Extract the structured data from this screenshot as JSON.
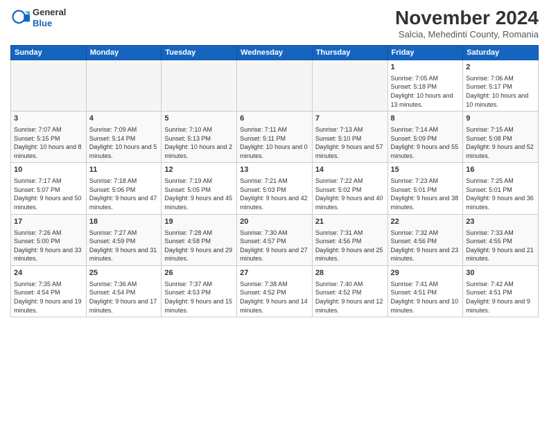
{
  "logo": {
    "general": "General",
    "blue": "Blue"
  },
  "header": {
    "month": "November 2024",
    "location": "Salcia, Mehedinti County, Romania"
  },
  "weekdays": [
    "Sunday",
    "Monday",
    "Tuesday",
    "Wednesday",
    "Thursday",
    "Friday",
    "Saturday"
  ],
  "weeks": [
    [
      {
        "day": "",
        "info": ""
      },
      {
        "day": "",
        "info": ""
      },
      {
        "day": "",
        "info": ""
      },
      {
        "day": "",
        "info": ""
      },
      {
        "day": "",
        "info": ""
      },
      {
        "day": "1",
        "info": "Sunrise: 7:05 AM\nSunset: 5:18 PM\nDaylight: 10 hours and 13 minutes."
      },
      {
        "day": "2",
        "info": "Sunrise: 7:06 AM\nSunset: 5:17 PM\nDaylight: 10 hours and 10 minutes."
      }
    ],
    [
      {
        "day": "3",
        "info": "Sunrise: 7:07 AM\nSunset: 5:15 PM\nDaylight: 10 hours and 8 minutes."
      },
      {
        "day": "4",
        "info": "Sunrise: 7:09 AM\nSunset: 5:14 PM\nDaylight: 10 hours and 5 minutes."
      },
      {
        "day": "5",
        "info": "Sunrise: 7:10 AM\nSunset: 5:13 PM\nDaylight: 10 hours and 2 minutes."
      },
      {
        "day": "6",
        "info": "Sunrise: 7:11 AM\nSunset: 5:11 PM\nDaylight: 10 hours and 0 minutes."
      },
      {
        "day": "7",
        "info": "Sunrise: 7:13 AM\nSunset: 5:10 PM\nDaylight: 9 hours and 57 minutes."
      },
      {
        "day": "8",
        "info": "Sunrise: 7:14 AM\nSunset: 5:09 PM\nDaylight: 9 hours and 55 minutes."
      },
      {
        "day": "9",
        "info": "Sunrise: 7:15 AM\nSunset: 5:08 PM\nDaylight: 9 hours and 52 minutes."
      }
    ],
    [
      {
        "day": "10",
        "info": "Sunrise: 7:17 AM\nSunset: 5:07 PM\nDaylight: 9 hours and 50 minutes."
      },
      {
        "day": "11",
        "info": "Sunrise: 7:18 AM\nSunset: 5:06 PM\nDaylight: 9 hours and 47 minutes."
      },
      {
        "day": "12",
        "info": "Sunrise: 7:19 AM\nSunset: 5:05 PM\nDaylight: 9 hours and 45 minutes."
      },
      {
        "day": "13",
        "info": "Sunrise: 7:21 AM\nSunset: 5:03 PM\nDaylight: 9 hours and 42 minutes."
      },
      {
        "day": "14",
        "info": "Sunrise: 7:22 AM\nSunset: 5:02 PM\nDaylight: 9 hours and 40 minutes."
      },
      {
        "day": "15",
        "info": "Sunrise: 7:23 AM\nSunset: 5:01 PM\nDaylight: 9 hours and 38 minutes."
      },
      {
        "day": "16",
        "info": "Sunrise: 7:25 AM\nSunset: 5:01 PM\nDaylight: 9 hours and 36 minutes."
      }
    ],
    [
      {
        "day": "17",
        "info": "Sunrise: 7:26 AM\nSunset: 5:00 PM\nDaylight: 9 hours and 33 minutes."
      },
      {
        "day": "18",
        "info": "Sunrise: 7:27 AM\nSunset: 4:59 PM\nDaylight: 9 hours and 31 minutes."
      },
      {
        "day": "19",
        "info": "Sunrise: 7:28 AM\nSunset: 4:58 PM\nDaylight: 9 hours and 29 minutes."
      },
      {
        "day": "20",
        "info": "Sunrise: 7:30 AM\nSunset: 4:57 PM\nDaylight: 9 hours and 27 minutes."
      },
      {
        "day": "21",
        "info": "Sunrise: 7:31 AM\nSunset: 4:56 PM\nDaylight: 9 hours and 25 minutes."
      },
      {
        "day": "22",
        "info": "Sunrise: 7:32 AM\nSunset: 4:56 PM\nDaylight: 9 hours and 23 minutes."
      },
      {
        "day": "23",
        "info": "Sunrise: 7:33 AM\nSunset: 4:55 PM\nDaylight: 9 hours and 21 minutes."
      }
    ],
    [
      {
        "day": "24",
        "info": "Sunrise: 7:35 AM\nSunset: 4:54 PM\nDaylight: 9 hours and 19 minutes."
      },
      {
        "day": "25",
        "info": "Sunrise: 7:36 AM\nSunset: 4:54 PM\nDaylight: 9 hours and 17 minutes."
      },
      {
        "day": "26",
        "info": "Sunrise: 7:37 AM\nSunset: 4:53 PM\nDaylight: 9 hours and 15 minutes."
      },
      {
        "day": "27",
        "info": "Sunrise: 7:38 AM\nSunset: 4:52 PM\nDaylight: 9 hours and 14 minutes."
      },
      {
        "day": "28",
        "info": "Sunrise: 7:40 AM\nSunset: 4:52 PM\nDaylight: 9 hours and 12 minutes."
      },
      {
        "day": "29",
        "info": "Sunrise: 7:41 AM\nSunset: 4:51 PM\nDaylight: 9 hours and 10 minutes."
      },
      {
        "day": "30",
        "info": "Sunrise: 7:42 AM\nSunset: 4:51 PM\nDaylight: 9 hours and 9 minutes."
      }
    ]
  ]
}
